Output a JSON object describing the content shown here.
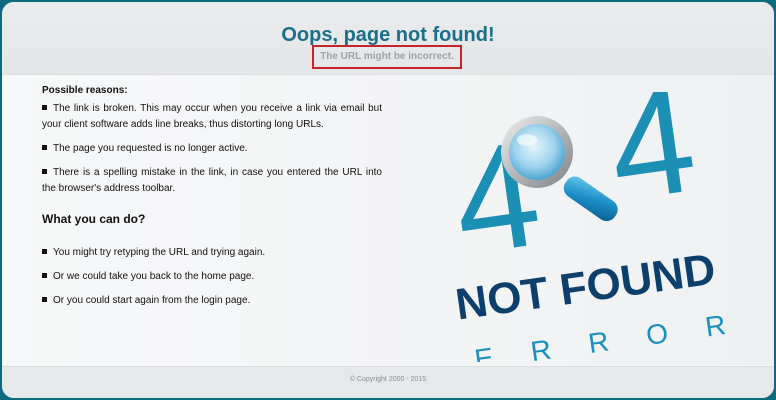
{
  "header": {
    "title": "Oops, page not found!",
    "subtitle": "The URL might be incorrect."
  },
  "reasons": {
    "heading": "Possible reasons:",
    "items": [
      "The link is broken. This may occur when you receive a link via email but your client software adds line breaks, thus distorting long URLs.",
      "The page you requested is no longer active.",
      "There is a spelling mistake in the link, in case you entered the URL into the browser's address toolbar."
    ]
  },
  "actions": {
    "heading": "What you can do?",
    "items": [
      "You might try retyping the URL and trying again.",
      "Or we could take you back to the home page.",
      "Or you could start again from the login page."
    ]
  },
  "graphic": {
    "digit_left": "4",
    "digit_right": "4",
    "line1": "NOT FOUND",
    "line2": "ERROR",
    "icon": "magnifying-glass-icon"
  },
  "footer": {
    "copyright": "© Copyright 2000 - 2015"
  },
  "colors": {
    "background_border": "#0e6a7e",
    "title": "#1a6f8a",
    "subtitle_box_border": "#c1262a",
    "digit": "#1c8fb5",
    "not_found": "#0d3f6d",
    "error": "#1a8fc0"
  }
}
